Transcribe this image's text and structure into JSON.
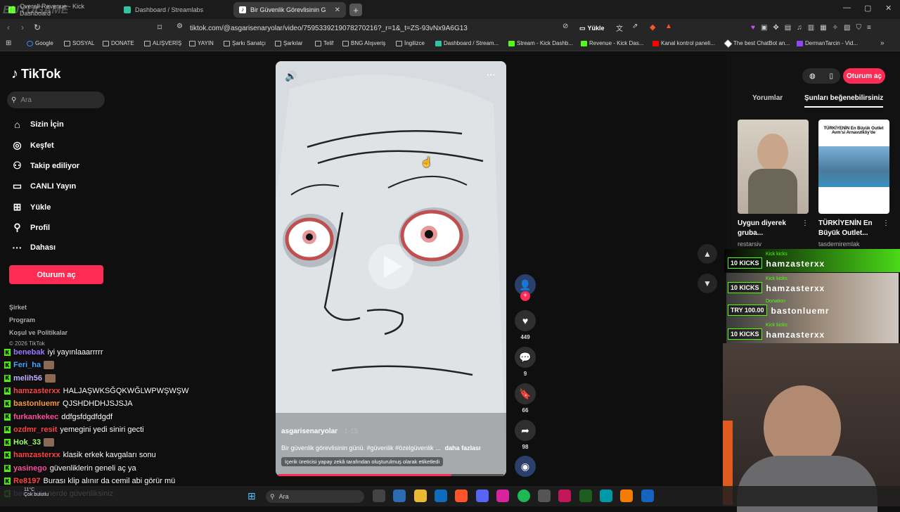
{
  "browser": {
    "watermark": "BUYUGAME",
    "tabs": [
      {
        "label": "Overall Revenue - Kick Dashboard",
        "color": "#53fc18"
      },
      {
        "label": "Dashboard / Streamlabs",
        "color": "#31c3a2"
      },
      {
        "label": "Bir Güvenlik Görevlisinin Gün...",
        "color": "#000000"
      }
    ],
    "url": "tiktok.com/@asgarisenaryolar/video/7595339219078270216?_r=1&_t=ZS-93vNx9A6G13",
    "upload_label": "Yükle",
    "bookmarks": [
      "Google",
      "SOSYAL",
      "DONATE",
      "ALIŞVERİŞ",
      "YAYIN",
      "Şarkı Sanatçı",
      "Şarkılar",
      "Telif",
      "BNG Alışveriş",
      "İngilizce",
      "Dashboard / Stream...",
      "Stream - Kick Dashb...",
      "Revenue - Kick Das...",
      "Kanal kontrol paneli...",
      "The best ChatBot an...",
      "DermanTarcin - Vid..."
    ]
  },
  "tiktok": {
    "logo": "TikTok",
    "search_placeholder": "Ara",
    "nav": [
      {
        "label": "Sizin İçin",
        "icon": "home-icon"
      },
      {
        "label": "Keşfet",
        "icon": "compass-icon"
      },
      {
        "label": "Takip ediliyor",
        "icon": "following-icon"
      },
      {
        "label": "CANLI Yayın",
        "icon": "live-icon"
      },
      {
        "label": "Yükle",
        "icon": "upload-icon"
      },
      {
        "label": "Profil",
        "icon": "profile-icon"
      },
      {
        "label": "Dahası",
        "icon": "more-icon"
      }
    ],
    "login": "Oturum aç",
    "footer": [
      "Şirket",
      "Program",
      "Koşul ve Politikalar",
      "© 2026 TikTok"
    ],
    "video": {
      "author": "asgarisenaryolar",
      "date": "· 1-15",
      "caption": "Bir güvenlik görevlisinin günü. #güvenlik #özelgüvenlik ...",
      "more": "daha fazlası",
      "ai_label": "İçerik üreticisi yapay zekâ tarafından oluşturulmuş olarak etiketledi",
      "progress": 0.77
    },
    "actions": {
      "likes": "449",
      "comments": "9",
      "saves": "66",
      "shares": "98"
    },
    "right": {
      "tab_comments": "Yorumlar",
      "tab_suggested": "Şunları beğenebilirsiniz",
      "cards": [
        {
          "title": "Uygun diyerek gruba...",
          "user": "restarsiv"
        },
        {
          "title": "TÜRKİYENİN En Büyük Outlet...",
          "user": "tasdemiremlak",
          "thumb_text": "TÜRKİYENİN En Büyük Outlet Avm'si Arnavutköy'de"
        }
      ]
    }
  },
  "chat": [
    {
      "user": "benebak",
      "color": "#9b7bff",
      "msg": "iyi yayınlaaarrrrr",
      "emote": false
    },
    {
      "user": "Feri_ha",
      "color": "#4aa3ff",
      "msg": "",
      "emote": true
    },
    {
      "user": "melih56",
      "color": "#c7b0ff",
      "msg": "",
      "emote": true
    },
    {
      "user": "hamzasterxx",
      "color": "#ff4444",
      "msg": "HALJAŞWKSĞQKWĞLWPWŞWŞW",
      "emote": false
    },
    {
      "user": "bastonluemr",
      "color": "#ff9a3c",
      "msg": "QJSHDHDHJSJSJA",
      "emote": false
    },
    {
      "user": "furkankekec",
      "color": "#ff4fa0",
      "msg": "ddfgsfdgdfdgdf",
      "emote": false
    },
    {
      "user": "ozdmr_resit",
      "color": "#ff4444",
      "msg": "yemegini yedi siniri gecti",
      "emote": false
    },
    {
      "user": "Hok_33",
      "color": "#9cff6e",
      "msg": "",
      "emote": true
    },
    {
      "user": "hamzasterxx",
      "color": "#ff4444",
      "msg": "klasik erkek kavgaları sonu",
      "emote": false
    },
    {
      "user": "yasinego",
      "color": "#ff4fa0",
      "msg": "güvenliklerin geneli aç ya",
      "emote": false
    },
    {
      "user": "Re8197",
      "color": "#ff4444",
      "msg": "Burası klip alınır da cemil abi görür mü",
      "emote": false
    },
    {
      "user": "benebak",
      "color": "#9b7bff",
      "msg": "nerde güvenliksiniz",
      "emote": false
    }
  ],
  "alerts": [
    {
      "badge": "10 KICKS",
      "sub": "Kick kicks",
      "name": "hamzasterxx"
    },
    {
      "badge": "10 KICKS",
      "sub": "Kick kicks",
      "name": "hamzasterxx"
    },
    {
      "badge": "TRY 100.00",
      "sub": "Donation",
      "name": "bastonluemr"
    },
    {
      "badge": "10 KICKS",
      "sub": "Kick kicks",
      "name": "hamzasterxx"
    }
  ],
  "taskbar": {
    "search": "Ara",
    "weather": "11°C",
    "weather_desc": "Çok bulutlu"
  }
}
